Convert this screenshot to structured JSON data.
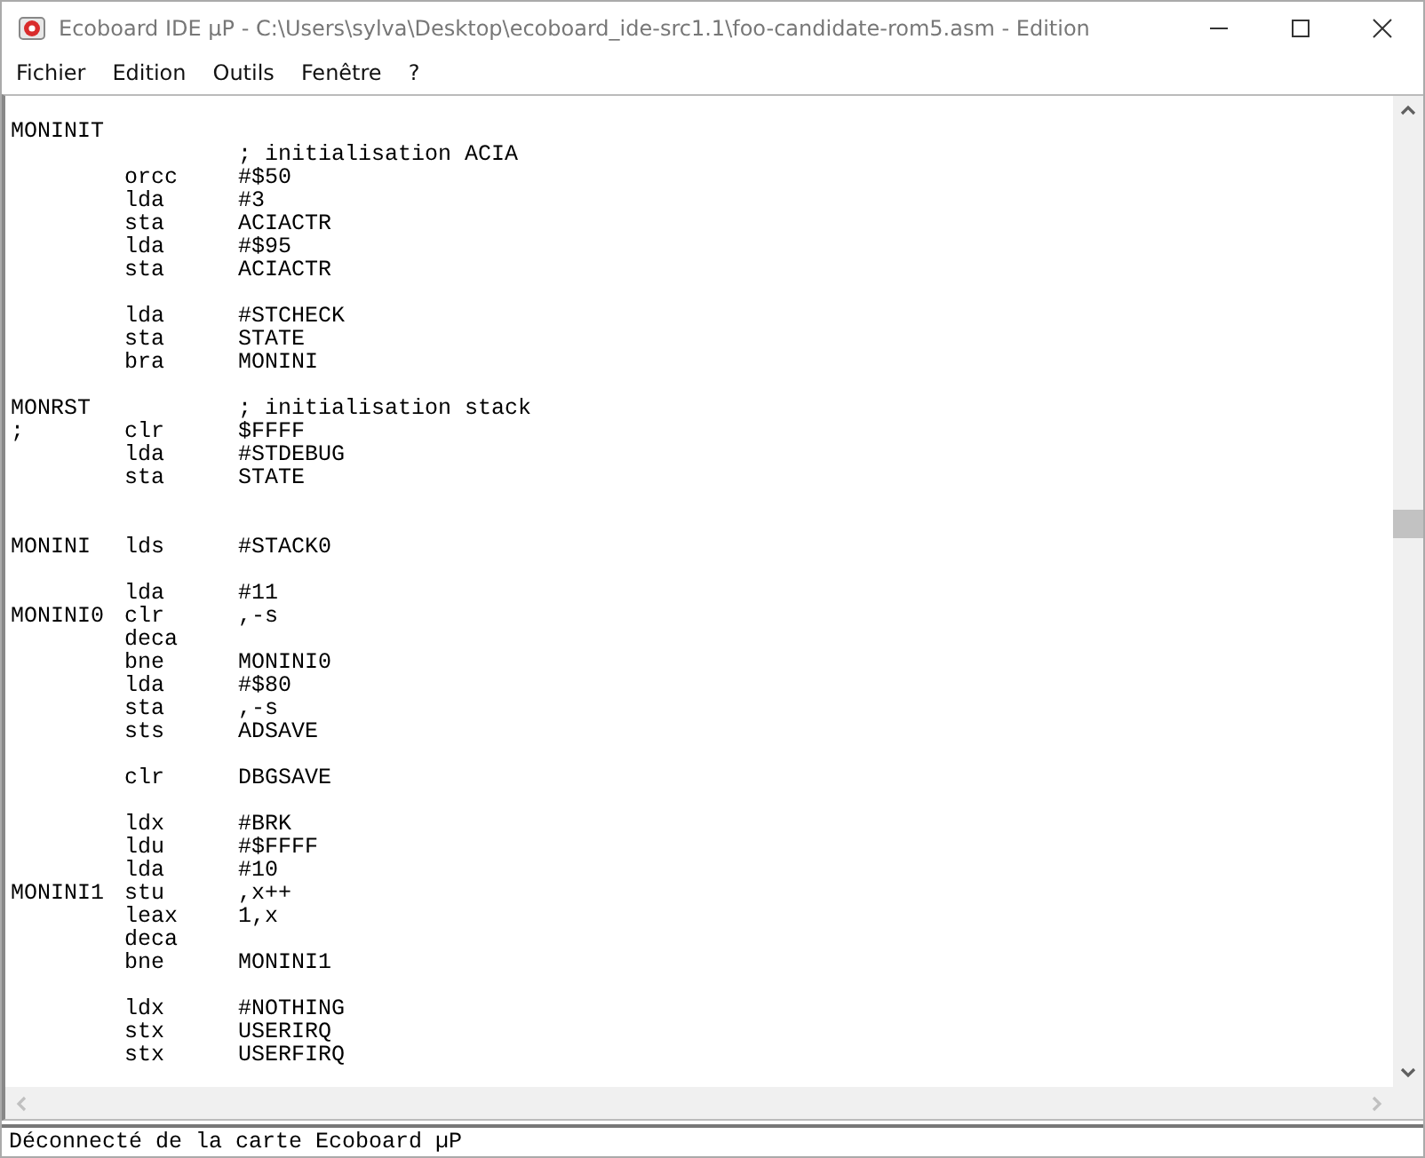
{
  "window": {
    "title": "Ecoboard IDE µP - C:\\Users\\sylva\\Desktop\\ecoboard_ide-src1.1\\foo-candidate-rom5.asm - Edition"
  },
  "menu": [
    "Fichier",
    "Edition",
    "Outils",
    "Fenêtre",
    "?"
  ],
  "editor": {
    "lines": [
      {
        "kind": "code",
        "label": "MONINIT"
      },
      {
        "kind": "code",
        "comment": "; initialisation ACIA"
      },
      {
        "kind": "code",
        "op": "orcc",
        "arg": "#$50"
      },
      {
        "kind": "code",
        "op": "lda",
        "arg": "#3"
      },
      {
        "kind": "code",
        "op": "sta",
        "arg": "ACIACTR"
      },
      {
        "kind": "code",
        "op": "lda",
        "arg": "#$95"
      },
      {
        "kind": "code",
        "op": "sta",
        "arg": "ACIACTR"
      },
      {
        "kind": "blank"
      },
      {
        "kind": "code",
        "op": "lda",
        "arg": "#STCHECK"
      },
      {
        "kind": "code",
        "op": "sta",
        "arg": "STATE"
      },
      {
        "kind": "code",
        "op": "bra",
        "arg": "MONINI"
      },
      {
        "kind": "blank"
      },
      {
        "kind": "code",
        "label": "MONRST",
        "comment": "; initialisation stack"
      },
      {
        "kind": "code",
        "label": ";",
        "op": "clr",
        "arg": "$FFFF"
      },
      {
        "kind": "code",
        "op": "lda",
        "arg": "#STDEBUG"
      },
      {
        "kind": "code",
        "op": "sta",
        "arg": "STATE"
      },
      {
        "kind": "blank"
      },
      {
        "kind": "blank"
      },
      {
        "kind": "code",
        "label": "MONINI",
        "op": "lds",
        "arg": "#STACK0"
      },
      {
        "kind": "blank"
      },
      {
        "kind": "code",
        "op": "lda",
        "arg": "#11"
      },
      {
        "kind": "code",
        "label": "MONINI0",
        "op": "clr",
        "arg": ",-s"
      },
      {
        "kind": "code",
        "op": "deca"
      },
      {
        "kind": "code",
        "op": "bne",
        "arg": "MONINI0"
      },
      {
        "kind": "code",
        "op": "lda",
        "arg": "#$80"
      },
      {
        "kind": "code",
        "op": "sta",
        "arg": ",-s"
      },
      {
        "kind": "code",
        "op": "sts",
        "arg": "ADSAVE"
      },
      {
        "kind": "blank"
      },
      {
        "kind": "code",
        "op": "clr",
        "arg": "DBGSAVE"
      },
      {
        "kind": "blank"
      },
      {
        "kind": "code",
        "op": "ldx",
        "arg": "#BRK"
      },
      {
        "kind": "code",
        "op": "ldu",
        "arg": "#$FFFF"
      },
      {
        "kind": "code",
        "op": "lda",
        "arg": "#10"
      },
      {
        "kind": "code",
        "label": "MONINI1",
        "op": "stu",
        "arg": ",x++"
      },
      {
        "kind": "code",
        "op": "leax",
        "arg": "1,x"
      },
      {
        "kind": "code",
        "op": "deca"
      },
      {
        "kind": "code",
        "op": "bne",
        "arg": "MONINI1"
      },
      {
        "kind": "blank"
      },
      {
        "kind": "code",
        "op": "ldx",
        "arg": "#NOTHING"
      },
      {
        "kind": "code",
        "op": "stx",
        "arg": "USERIRQ"
      },
      {
        "kind": "code",
        "op": "stx",
        "arg": "USERFIRQ"
      }
    ]
  },
  "status_bar": "Déconnecté de la carte Ecoboard µP"
}
